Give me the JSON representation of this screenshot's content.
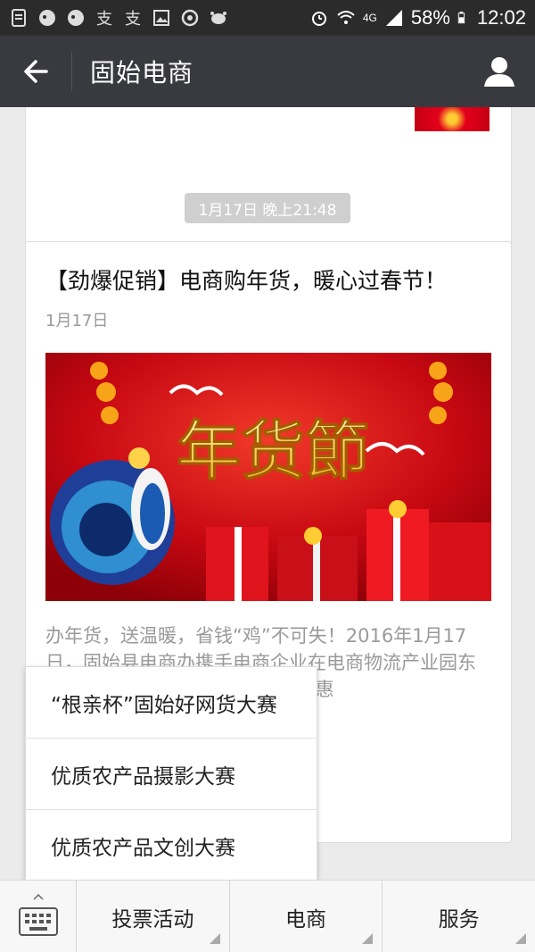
{
  "status_bar": {
    "network": "4G",
    "battery": "58%",
    "time": "12:02"
  },
  "header": {
    "title": "固始电商"
  },
  "feed": {
    "time_chip": "1月17日 晚上21:48",
    "article": {
      "title": "【劲爆促销】电商购年货，暖心过春节！",
      "date": "1月17日",
      "banner_text": "年货節",
      "excerpt": "办年货，送温暖，省钱“鸡”不可失！2016年1月17日，固始县电商办携手电商企业在电商物流产业园东400米路北），电商企业及合作社惠"
    }
  },
  "popup_menu": {
    "items": [
      {
        "label": "“根亲杯”固始好网货大赛"
      },
      {
        "label": "优质农产品摄影大赛"
      },
      {
        "label": "优质农产品文创大赛"
      }
    ]
  },
  "bottom_menu": {
    "items": [
      {
        "label": "投票活动"
      },
      {
        "label": "电商"
      },
      {
        "label": "服务"
      }
    ]
  },
  "colors": {
    "status_bar": "#2b2b2b",
    "app_bar": "#393a3f",
    "page_bg": "#ebebeb",
    "banner_red": "#d60a14"
  }
}
